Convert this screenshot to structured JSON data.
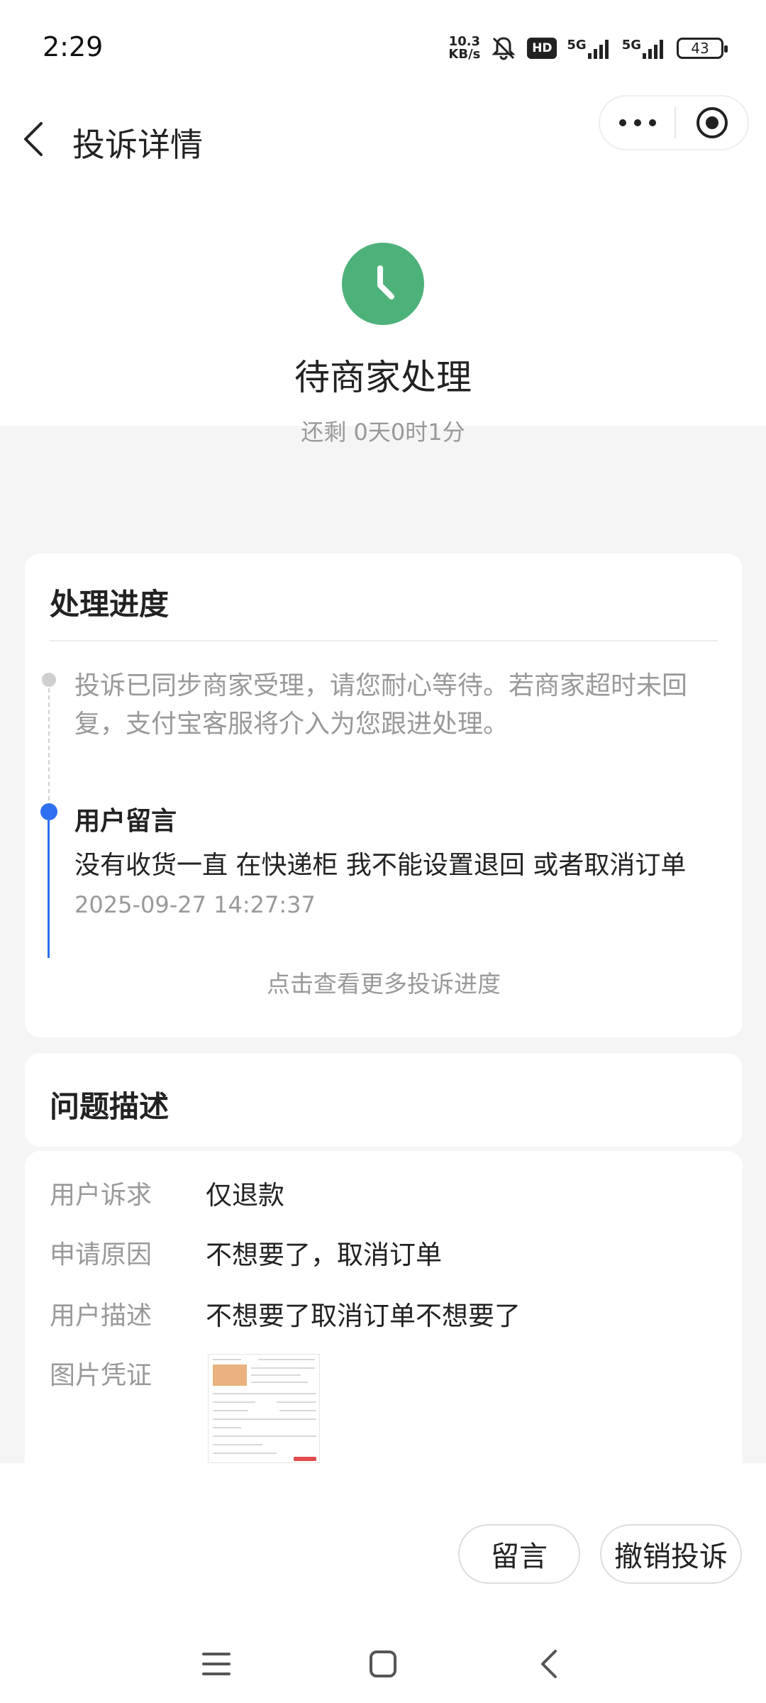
{
  "status_bar": {
    "time": "2:29",
    "net_speed_value": "10.3",
    "net_speed_unit": "KB/s",
    "hd_label": "HD",
    "sim1_label": "5G",
    "sim2_label": "5G",
    "battery": "43"
  },
  "header": {
    "title": "投诉详情"
  },
  "status": {
    "title": "待商家处理",
    "remaining": "还剩 0天0时1分",
    "icon_color": "#4db27a"
  },
  "progress": {
    "title": "处理进度",
    "step1_text": "投诉已同步商家受理，请您耐心等待。若商家超时未回复，支付宝客服将介入为您跟进处理。",
    "step2_title": "用户留言",
    "step2_message": "没有收货一直 在快递柜 我不能设置退回 或者取消订单",
    "step2_time": "2025-09-27 14:27:37",
    "more_link": "点击查看更多投诉进度",
    "accent_color": "#2f6ff0"
  },
  "description": {
    "title": "问题描述",
    "rows": [
      {
        "label": "用户诉求",
        "value": "仅退款"
      },
      {
        "label": "申请原因",
        "value": "不想要了，取消订单"
      },
      {
        "label": "用户描述",
        "value": "不想要了取消订单不想要了"
      },
      {
        "label": "图片凭证",
        "value": ""
      }
    ]
  },
  "actions": {
    "message_label": "留言",
    "withdraw_label": "撤销投诉"
  }
}
